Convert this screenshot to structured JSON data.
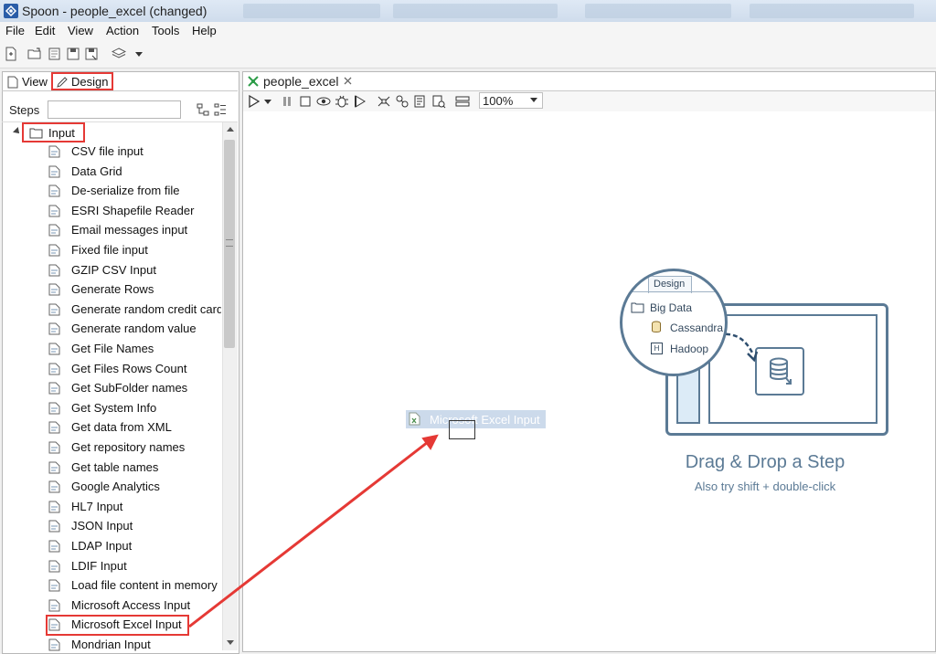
{
  "window": {
    "title": "Spoon - people_excel (changed)"
  },
  "menu": [
    "File",
    "Edit",
    "View",
    "Action",
    "Tools",
    "Help"
  ],
  "left_tabs": {
    "view": "View",
    "design": "Design"
  },
  "steps": {
    "label": "Steps",
    "search_placeholder": ""
  },
  "tree": {
    "category": "Input",
    "items": [
      "CSV file input",
      "Data Grid",
      "De-serialize from file",
      "ESRI Shapefile Reader",
      "Email messages input",
      "Fixed file input",
      "GZIP CSV Input",
      "Generate Rows",
      "Generate random credit card numbers",
      "Generate random value",
      "Get File Names",
      "Get Files Rows Count",
      "Get SubFolder names",
      "Get System Info",
      "Get data from XML",
      "Get repository names",
      "Get table names",
      "Google Analytics",
      "HL7 Input",
      "JSON Input",
      "LDAP Input",
      "LDIF Input",
      "Load file content in memory",
      "Microsoft Access Input",
      "Microsoft Excel Input",
      "Mondrian Input"
    ],
    "highlighted_item": "Microsoft Excel Input"
  },
  "editor": {
    "tab_label": "people_excel",
    "zoom": "100%",
    "dragged_step": "Microsoft Excel Input"
  },
  "illustration": {
    "tab": "Design",
    "folder": "Big Data",
    "item1": "Cassandra",
    "item2": "Hadoop",
    "item2_icon_letter": "H",
    "title": "Drag & Drop a Step",
    "subtitle": "Also try shift + double-click"
  },
  "colors": {
    "highlight": "#e53935",
    "accent": "#5b7a95",
    "drag_bg": "#c4d4e8"
  }
}
